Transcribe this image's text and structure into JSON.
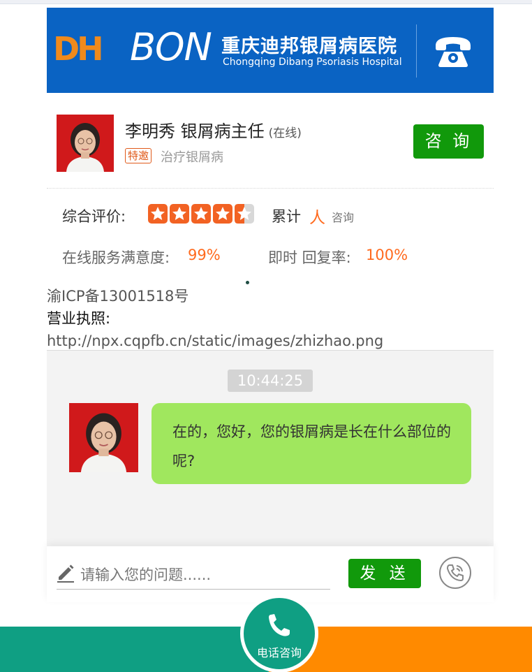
{
  "header": {
    "logo_dh": "DH",
    "logo_bon": "BON",
    "hospital_name_cn": "重庆迪邦银屑病医院",
    "hospital_name_en": "Chongqing Dibang Psoriasis Hospital",
    "phone_icon": "telephone-icon",
    "brand_color": "#0a63c3",
    "accent_color": "#f08a1c"
  },
  "doctor": {
    "name_title": "李明秀 银屑病主任",
    "status": "(在线)",
    "tag": "特邀",
    "description": "治疗银屑病",
    "consult_label": "咨 询"
  },
  "rating": {
    "label": "综合评价:",
    "stars": 4.5,
    "stars_max": 5,
    "total_label": "累计",
    "total_unit": "人",
    "total_suffix": "咨询"
  },
  "stats": {
    "satisfaction_label": "在线服务满意度:",
    "satisfaction_value": "99%",
    "reply_label": "即时 回复率:",
    "reply_value": "100%"
  },
  "footer": {
    "icp": "渝ICP备13001518号",
    "license_label": "营业执照:",
    "license_url": "http://npx.cqpfb.cn/static/images/zhizhao.png"
  },
  "chat": {
    "time": "10:44:25",
    "message": "在的，您好，您的银屑病是长在什么部位的呢?"
  },
  "input": {
    "placeholder": "请输入您的问题......",
    "send_label": "发 送"
  },
  "bottom": {
    "call_label": "电话咨询",
    "left_color": "#0f9f83",
    "right_color": "#ff8a00"
  }
}
